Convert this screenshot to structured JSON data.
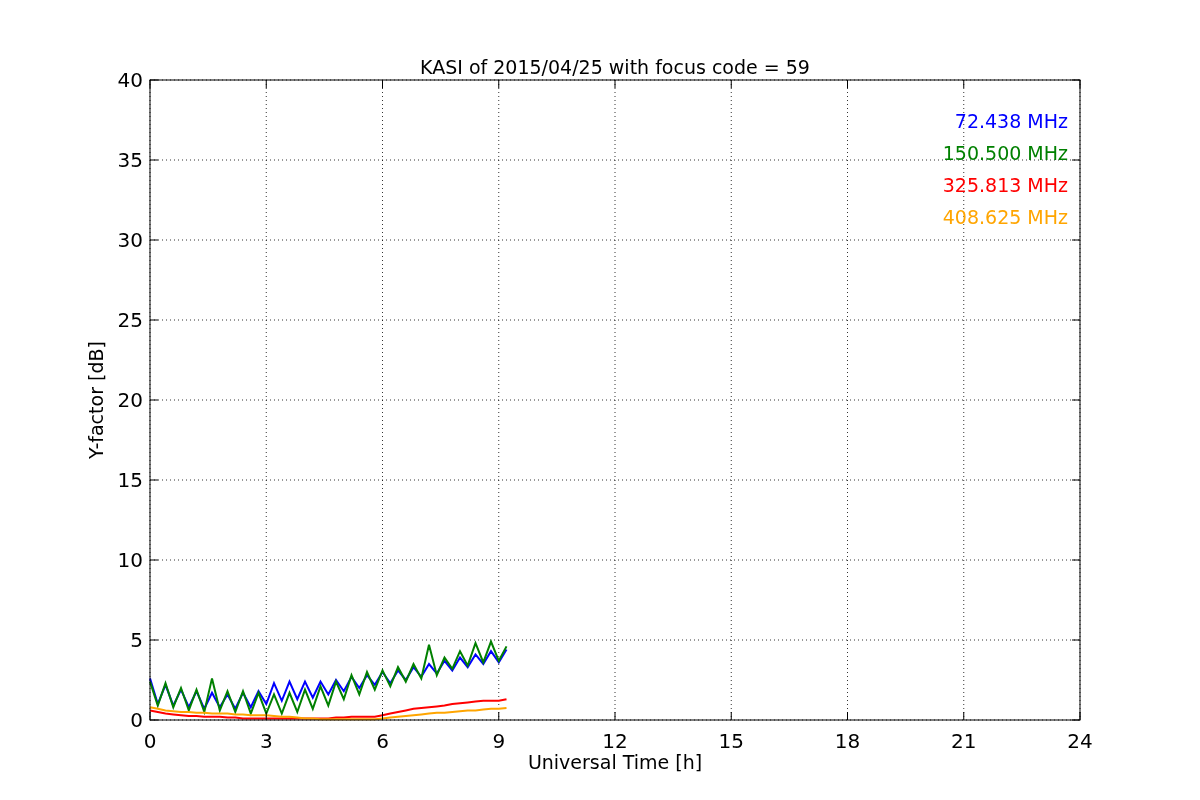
{
  "chart_data": {
    "type": "line",
    "title": "KASI of 2015/04/25 with focus code = 59",
    "xlabel": "Universal Time [h]",
    "ylabel": "Y-factor [dB]",
    "x": [
      0,
      0.2,
      0.4,
      0.6,
      0.8,
      1,
      1.2,
      1.4,
      1.6,
      1.8,
      2,
      2.2,
      2.4,
      2.6,
      2.8,
      3,
      3.2,
      3.4,
      3.6,
      3.8,
      4,
      4.2,
      4.4,
      4.6,
      4.8,
      5,
      5.2,
      5.4,
      5.6,
      5.8,
      6,
      6.2,
      6.4,
      6.6,
      6.8,
      7,
      7.2,
      7.4,
      7.6,
      7.8,
      8,
      8.2,
      8.4,
      8.6,
      8.8,
      9,
      9.2
    ],
    "series": [
      {
        "name": "72.438 MHz",
        "color": "#0000ff",
        "values": [
          2.6,
          1.0,
          2.2,
          0.9,
          1.9,
          0.8,
          1.8,
          0.7,
          1.7,
          0.8,
          1.6,
          0.7,
          1.7,
          0.8,
          1.8,
          1.0,
          2.3,
          1.2,
          2.4,
          1.3,
          2.4,
          1.4,
          2.4,
          1.6,
          2.5,
          1.8,
          2.7,
          2.0,
          2.8,
          2.2,
          3.0,
          2.3,
          3.1,
          2.5,
          3.3,
          2.7,
          3.5,
          2.9,
          3.7,
          3.1,
          3.9,
          3.3,
          4.1,
          3.5,
          4.3,
          3.6,
          4.4
        ]
      },
      {
        "name": "150.500 MHz",
        "color": "#008000",
        "values": [
          2.4,
          0.9,
          2.3,
          0.8,
          2.0,
          0.6,
          1.9,
          0.5,
          2.6,
          0.6,
          1.8,
          0.5,
          1.8,
          0.4,
          1.7,
          0.4,
          1.6,
          0.4,
          1.7,
          0.5,
          1.9,
          0.7,
          2.1,
          0.9,
          2.4,
          1.3,
          2.8,
          1.6,
          3.0,
          1.9,
          3.1,
          2.1,
          3.3,
          2.4,
          3.5,
          2.6,
          4.7,
          2.8,
          3.9,
          3.2,
          4.3,
          3.4,
          4.8,
          3.6,
          4.9,
          3.7,
          4.6
        ]
      },
      {
        "name": "325.813 MHz",
        "color": "#ff0000",
        "values": [
          0.6,
          0.5,
          0.4,
          0.35,
          0.3,
          0.25,
          0.25,
          0.2,
          0.2,
          0.2,
          0.15,
          0.15,
          0.1,
          0.1,
          0.1,
          0.1,
          0.1,
          0.1,
          0.1,
          0.1,
          0.1,
          0.1,
          0.1,
          0.1,
          0.15,
          0.15,
          0.2,
          0.2,
          0.2,
          0.2,
          0.3,
          0.4,
          0.5,
          0.6,
          0.7,
          0.75,
          0.8,
          0.85,
          0.9,
          1.0,
          1.05,
          1.1,
          1.15,
          1.2,
          1.2,
          1.2,
          1.3
        ]
      },
      {
        "name": "408.625 MHz",
        "color": "#ffa500",
        "values": [
          0.8,
          0.7,
          0.6,
          0.55,
          0.5,
          0.5,
          0.45,
          0.45,
          0.4,
          0.4,
          0.4,
          0.35,
          0.35,
          0.3,
          0.3,
          0.3,
          0.25,
          0.2,
          0.2,
          0.15,
          0.1,
          0.1,
          0.05,
          0.05,
          0.05,
          0.05,
          0.05,
          0.05,
          0.05,
          0.05,
          0.1,
          0.15,
          0.2,
          0.25,
          0.3,
          0.35,
          0.4,
          0.45,
          0.45,
          0.5,
          0.55,
          0.6,
          0.6,
          0.65,
          0.7,
          0.7,
          0.75
        ]
      }
    ],
    "xlim": [
      0,
      24
    ],
    "ylim": [
      0,
      40
    ],
    "grid": true,
    "xticks": [
      0,
      3,
      6,
      9,
      12,
      15,
      18,
      21,
      24
    ],
    "yticks": [
      0,
      5,
      10,
      15,
      20,
      25,
      30,
      35,
      40
    ]
  }
}
